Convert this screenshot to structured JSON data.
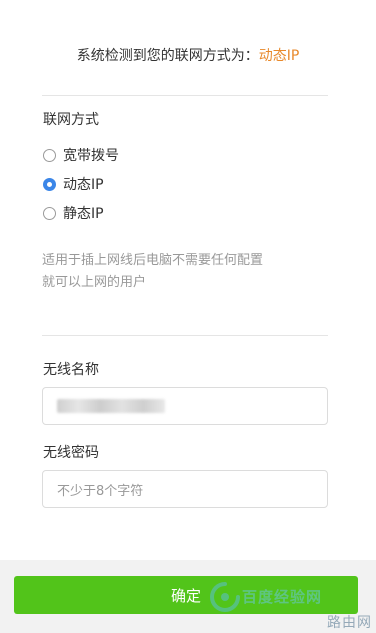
{
  "detection": {
    "prefix": "系统检测到您的联网方式为：",
    "mode": "动态IP"
  },
  "connection": {
    "label": "联网方式",
    "options": [
      {
        "label": "宽带拨号",
        "checked": false
      },
      {
        "label": "动态IP",
        "checked": true
      },
      {
        "label": "静态IP",
        "checked": false
      }
    ],
    "description_line1": "适用于插上网线后电脑不需要任何配置",
    "description_line2": "就可以上网的用户"
  },
  "wireless": {
    "name_label": "无线名称",
    "password_label": "无线密码",
    "password_placeholder": "不少于8个字符"
  },
  "confirm_button": "确定",
  "colors": {
    "accent_orange": "#e8892b",
    "radio_blue": "#3b86e8",
    "button_green": "#52c41a"
  },
  "watermark": {
    "line1": "百度经验网",
    "line2": "路由网"
  }
}
